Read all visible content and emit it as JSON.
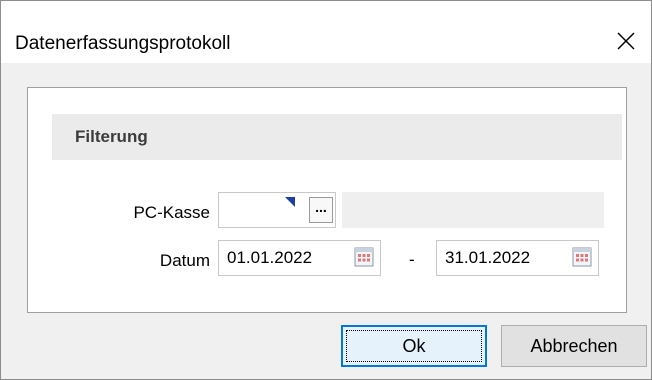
{
  "window": {
    "title": "Datenerfassungsprotokoll"
  },
  "group": {
    "title": "Filterung"
  },
  "fields": {
    "pc_kasse_label": "PC-Kasse",
    "pc_kasse_button": "...",
    "datum_label": "Datum",
    "date_from": "01.01.2022",
    "date_separator": "-",
    "date_to": "31.01.2022"
  },
  "buttons": {
    "ok": "Ok",
    "cancel": "Abbrechen"
  },
  "icons": {
    "close": "close-icon",
    "calendar": "calendar-icon",
    "marker": "field-marker-icon"
  },
  "colors": {
    "accent": "#0078d7",
    "marker": "#1f3fa0"
  }
}
